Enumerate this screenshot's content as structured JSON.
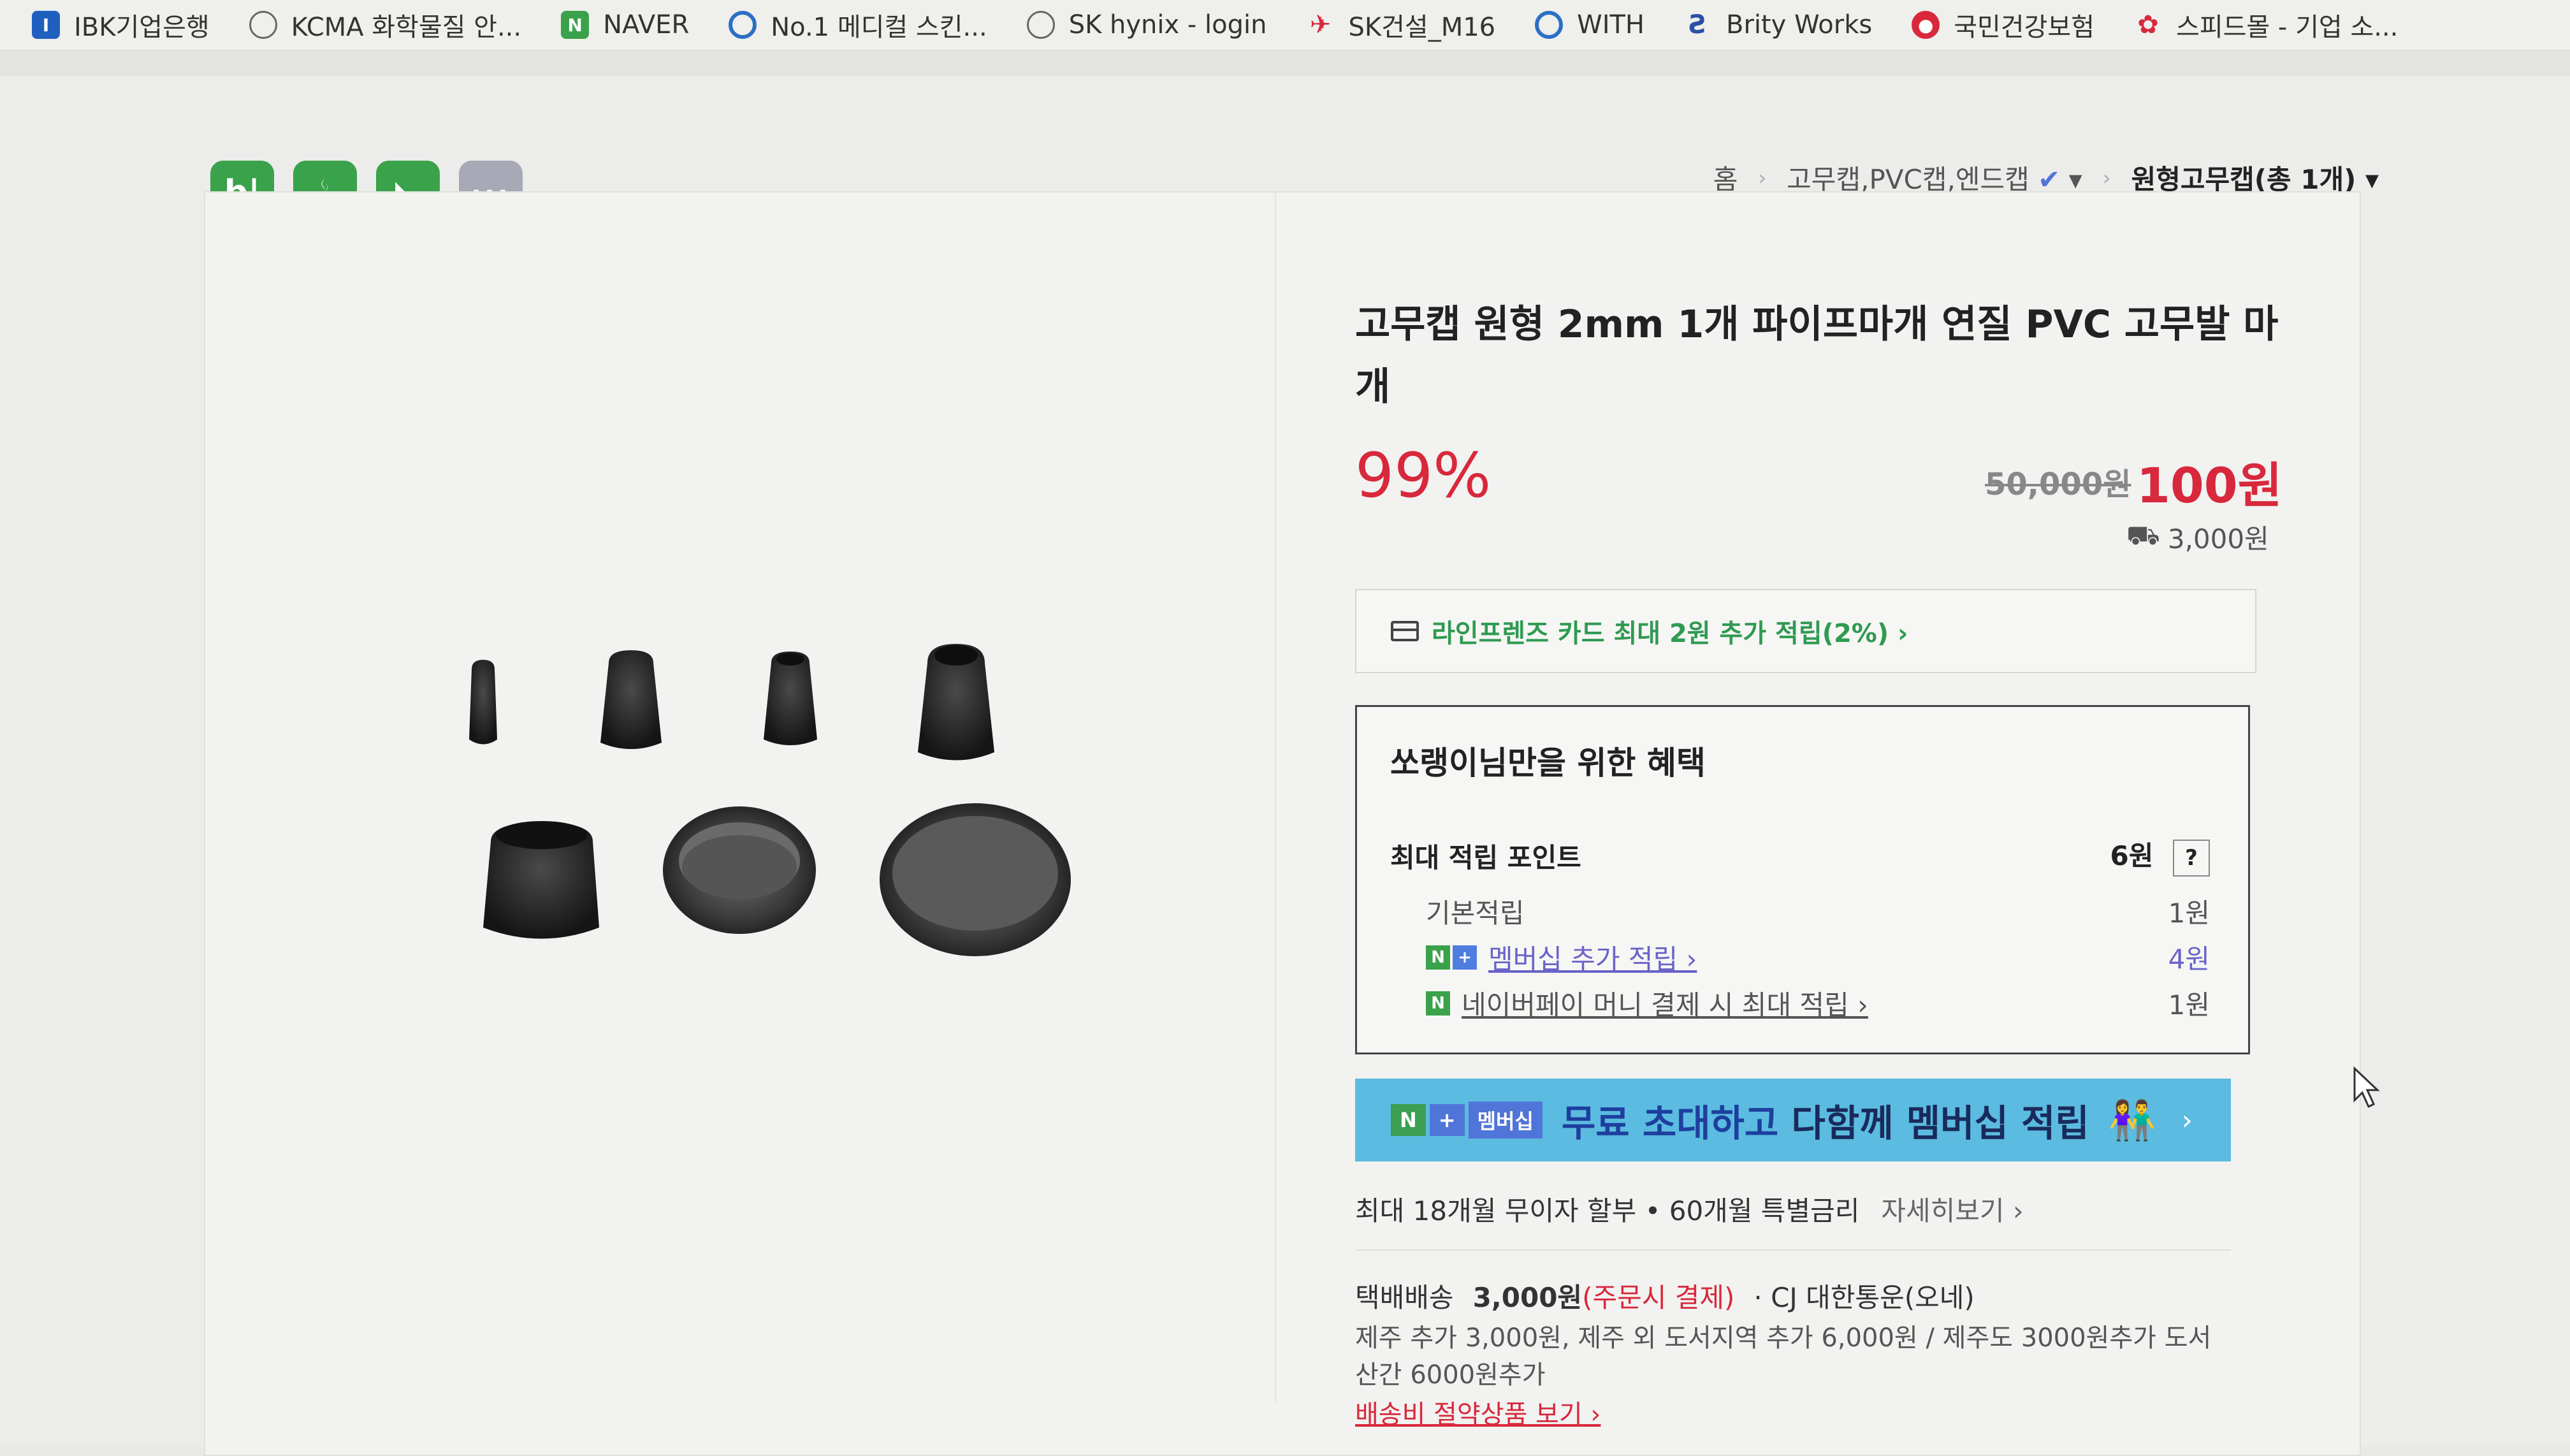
{
  "bookmarks": [
    {
      "label": "IBK기업은행",
      "icon": "ibk-icon",
      "color": "#1f5fbf"
    },
    {
      "label": "KCMA 화학물질 안...",
      "icon": "globe-icon",
      "color": "#666666"
    },
    {
      "label": "NAVER",
      "icon": "naver-icon",
      "color": "#3aa24a"
    },
    {
      "label": "No.1 메디컬 스킨...",
      "icon": "circle-icon",
      "color": "#2b6fc6"
    },
    {
      "label": "SK hynix - login",
      "icon": "globe-icon",
      "color": "#666666"
    },
    {
      "label": "SK건설_M16",
      "icon": "sk-icon",
      "color": "#d8283c"
    },
    {
      "label": "WITH",
      "icon": "circle-icon",
      "color": "#2b6fc6"
    },
    {
      "label": "Brity Works",
      "icon": "brity-icon",
      "color": "#2b4fa6"
    },
    {
      "label": "국민건강보험",
      "icon": "nhis-icon",
      "color": "#d8283c"
    },
    {
      "label": "스피드몰 - 기업 소...",
      "icon": "speedmall-icon",
      "color": "#d8283c"
    }
  ],
  "share": {
    "blog_label": "b|",
    "cafe_label": "☕",
    "bookmark_label": "◣",
    "more_label": "···"
  },
  "breadcrumb": {
    "home": "홈",
    "category": "고무캡,PVC캡,엔드캡",
    "current": "원형고무캡(총 1개)"
  },
  "product": {
    "title": "고무캡 원형 2mm 1개 파이프마개 연질 PVC 고무발 마개",
    "discount": "99%",
    "original_price": "50,000원",
    "sale_price": "100원",
    "shipping_fee": "3,000원"
  },
  "card_promo": {
    "text": "라인프렌즈 카드 최대 2원 추가 적립(2%) ›"
  },
  "benefits": {
    "title": "쏘랭이님만을 위한 혜택",
    "max_points_label": "최대 적립 포인트",
    "max_points_value": "6원",
    "help": "?",
    "rows": [
      {
        "label": "기본적립",
        "value": "1원"
      },
      {
        "label": "멤버십 추가 적립 ›",
        "value": "4원"
      },
      {
        "label": "네이버페이 머니 결제 시 최대 적립 ›",
        "value": "1원"
      }
    ]
  },
  "membership_banner": {
    "badge_n": "N",
    "badge_plus": "+",
    "badge_text": "멤버십",
    "text_a": "무료 초대하고 ",
    "text_b": "다함께 멤버십 적립",
    "arrow": "›"
  },
  "installment": {
    "text": "최대 18개월 무이자 할부 • 60개월 특별금리",
    "more": "자세히보기 ›"
  },
  "delivery": {
    "method": "택배배송",
    "fee": "3,000원",
    "fee_note": "(주문시 결제)",
    "carrier": "· CJ 대한통운(오네)",
    "note": "제주 추가 3,000원, 제주 외 도서지역 추가 6,000원 / 제주도 3000원추가 도서산간 6000원추가",
    "link": "배송비 절약상품 보기 ›"
  },
  "colors": {
    "accent_red": "#d8283c",
    "naver_green": "#3aa24a",
    "banner_blue": "#5bbbe0"
  }
}
